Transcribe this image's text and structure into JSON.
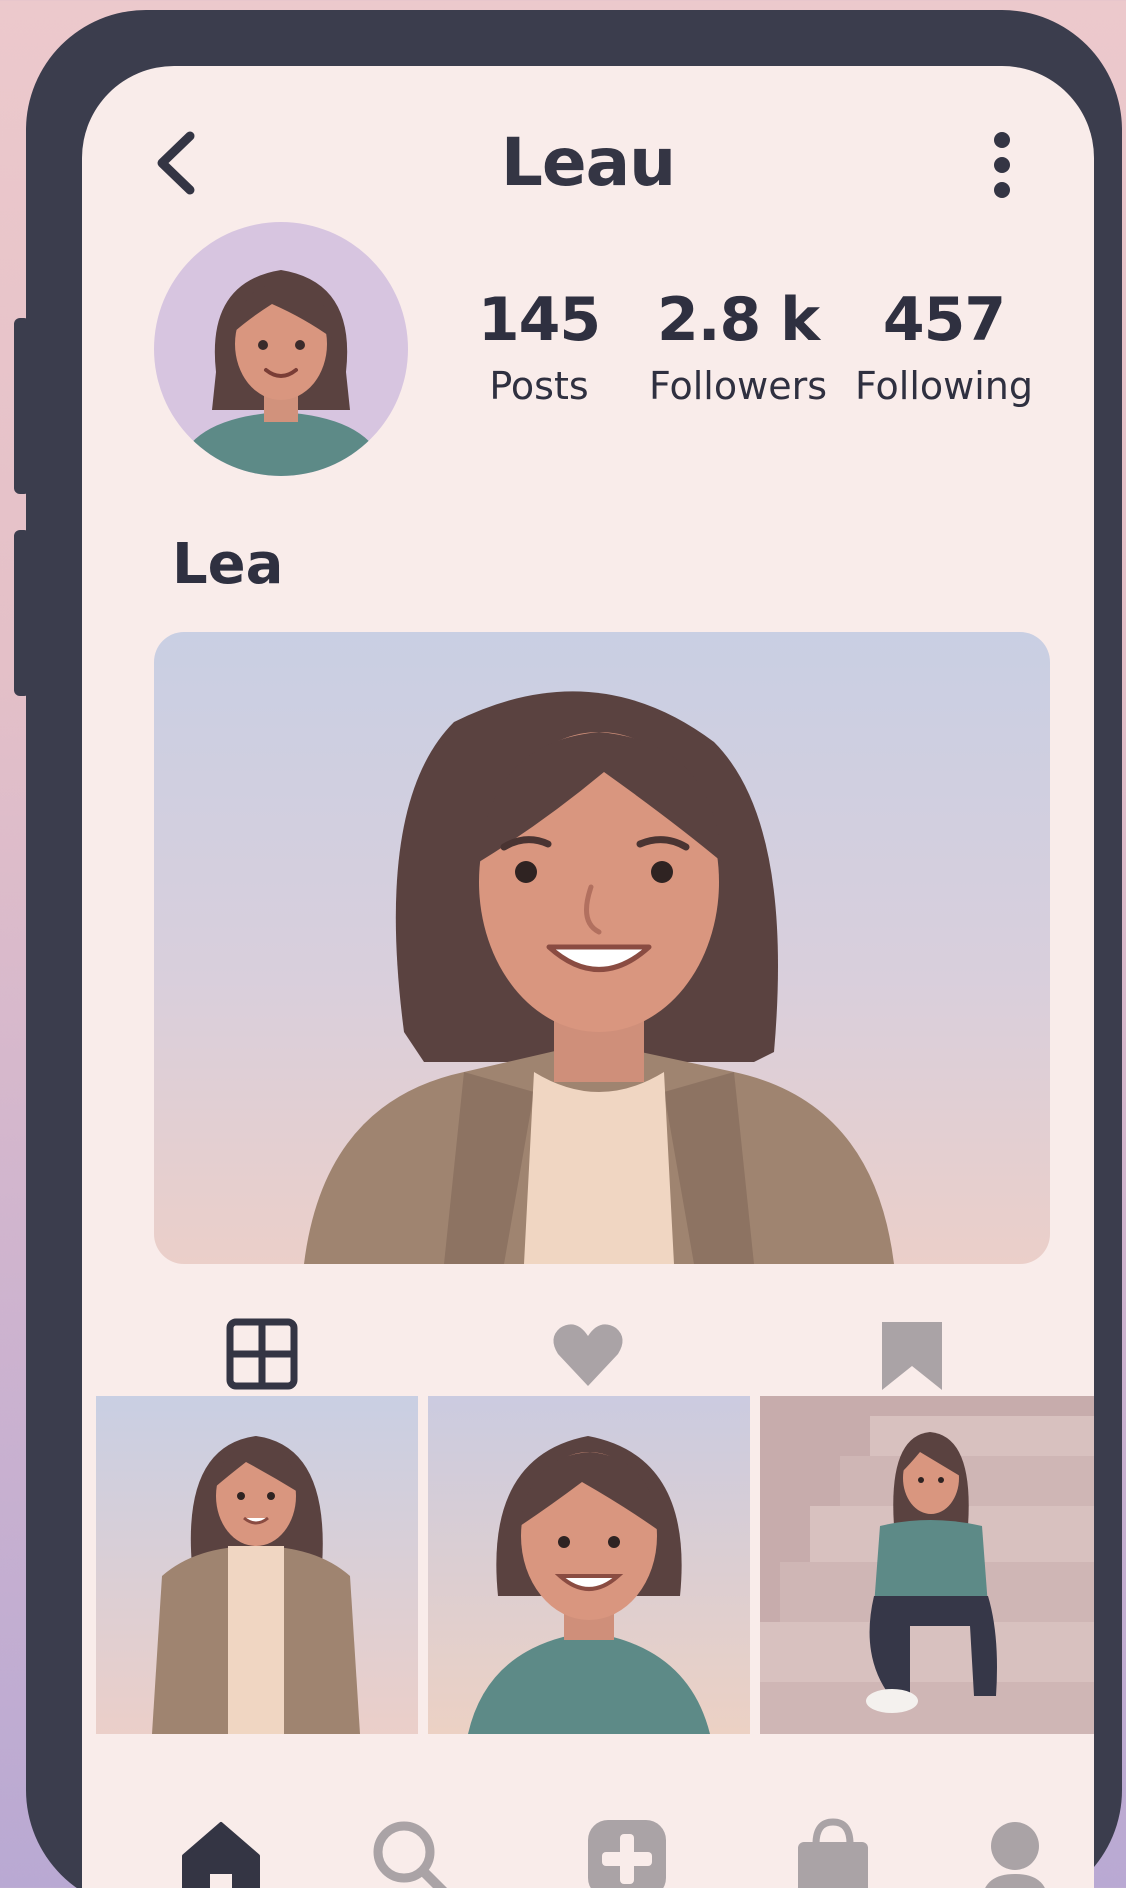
{
  "header": {
    "title": "Leau"
  },
  "profile": {
    "display_name": "Lea",
    "stats": [
      {
        "value": "145",
        "label": "Posts"
      },
      {
        "value": "2.8 k",
        "label": "Followers"
      },
      {
        "value": "457",
        "label": "Following"
      }
    ]
  },
  "icons": {
    "back": "chevron-left-icon",
    "more": "kebab-menu-icon",
    "tabs": [
      "grid-icon",
      "heart-icon",
      "bookmark-icon"
    ],
    "nav": [
      "home-icon",
      "search-icon",
      "add-post-icon",
      "shop-icon",
      "profile-icon"
    ]
  },
  "colors": {
    "screen_bg": "#f9ecea",
    "frame": "#3b3d4d",
    "text": "#2f3040",
    "icon_inactive": "#aaa3a6"
  }
}
